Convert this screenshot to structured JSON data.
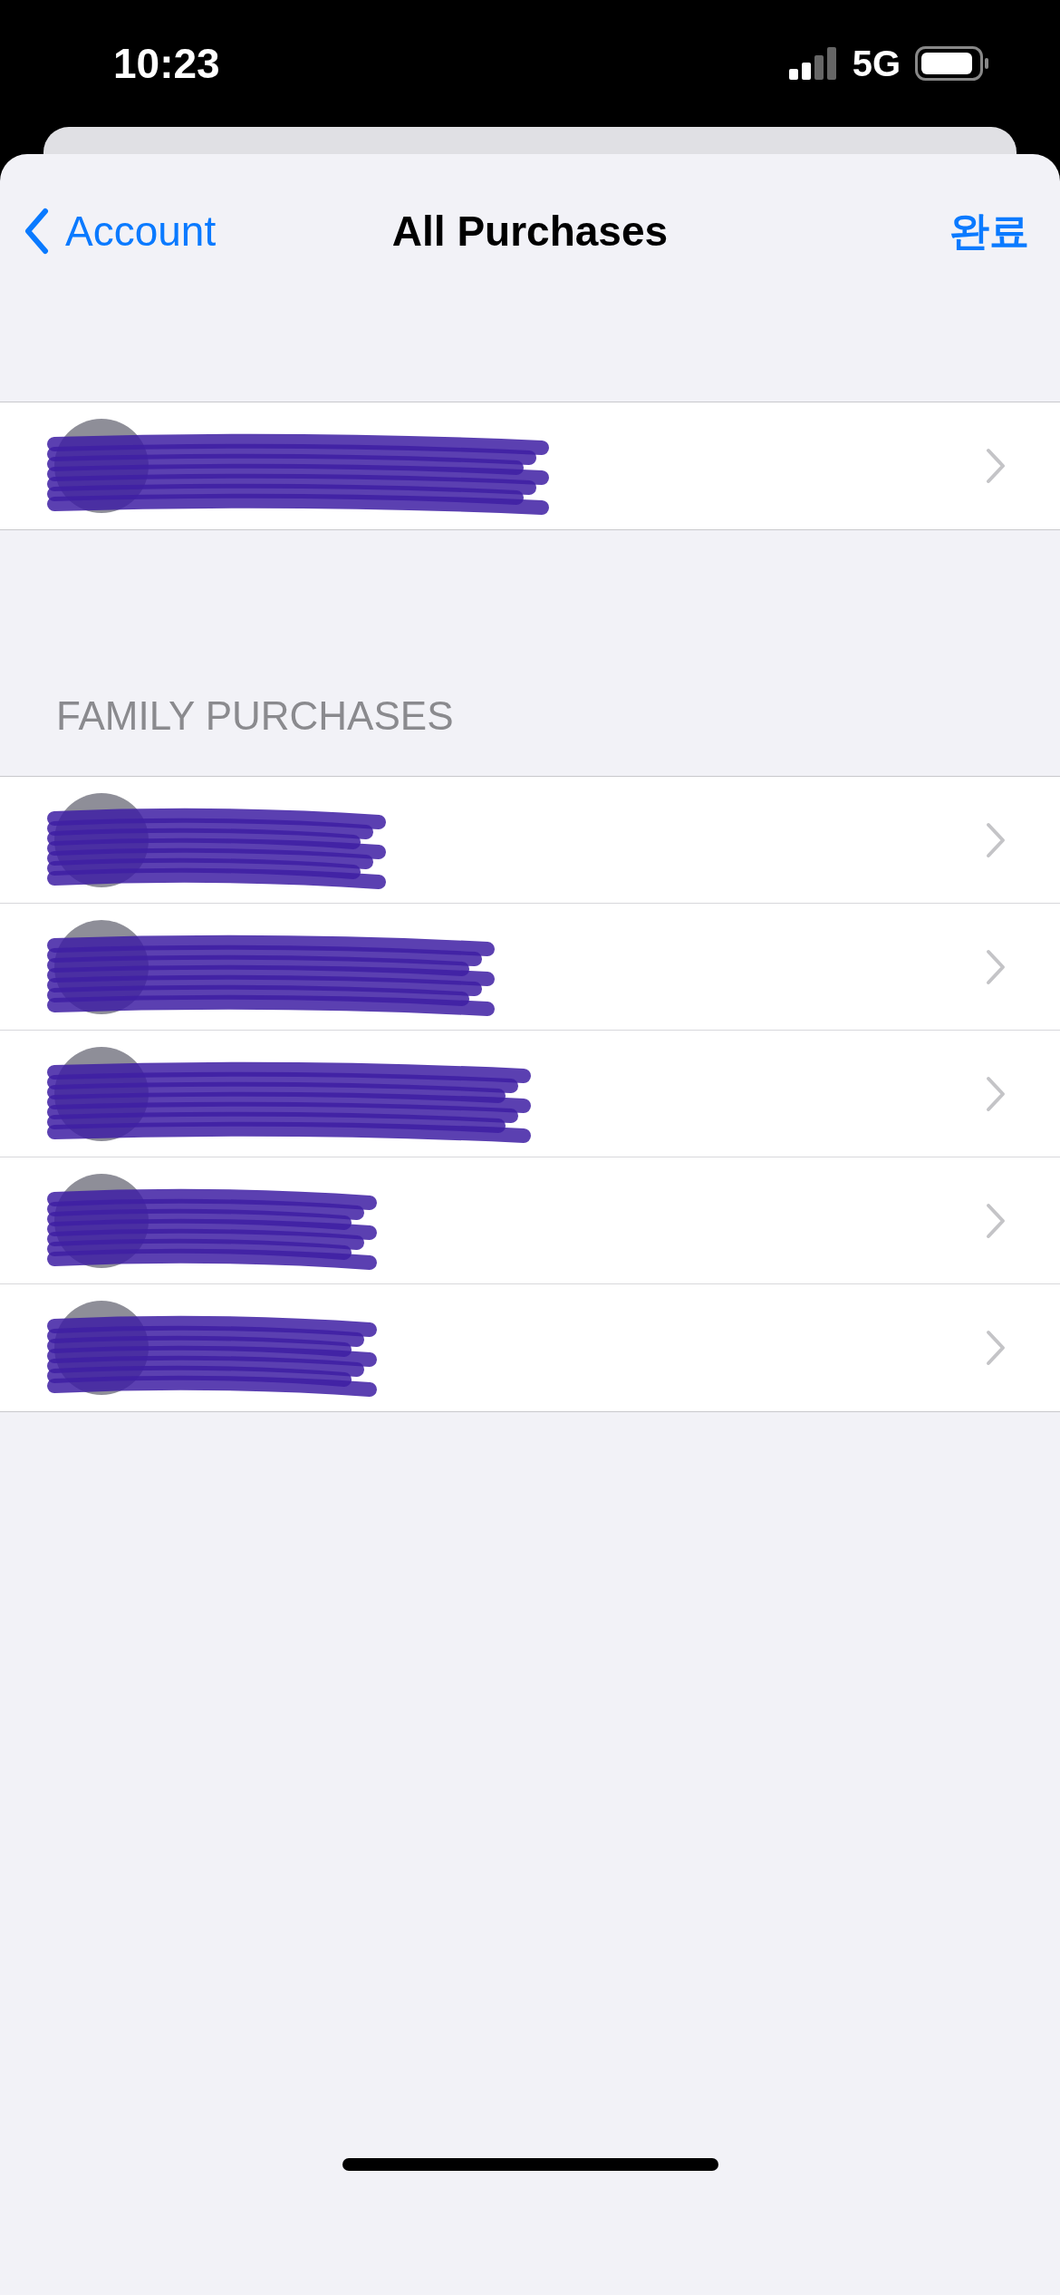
{
  "status_bar": {
    "time": "10:23",
    "network": "5G"
  },
  "nav": {
    "back": "Account",
    "title": "All Purchases",
    "done": "완료"
  },
  "account_rows": [
    {
      "kind": "redacted"
    }
  ],
  "family": {
    "header": "FAMILY PURCHASES",
    "rows": [
      {
        "kind": "redacted"
      },
      {
        "kind": "redacted"
      },
      {
        "kind": "redacted"
      },
      {
        "kind": "redacted"
      },
      {
        "kind": "redacted"
      }
    ]
  }
}
